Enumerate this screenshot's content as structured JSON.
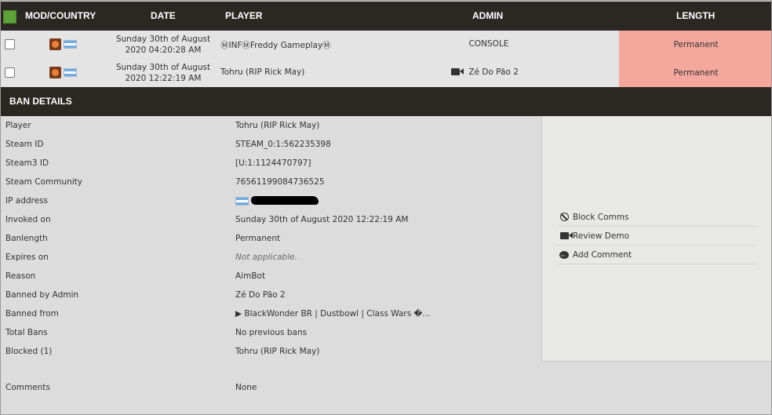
{
  "columns": {
    "mod_country": "MOD/COUNTRY",
    "date": "DATE",
    "player": "PLAYER",
    "admin": "ADMIN",
    "length": "LENGTH"
  },
  "bans": [
    {
      "date_line1": "Sunday 30th of August",
      "date_line2": "2020 04:20:28 AM",
      "player": "ⓂINFⓂFreddy GameplayⓂ",
      "admin": "CONSOLE",
      "admin_has_demo_icon": false,
      "length": "Permanent",
      "flag_icon": "argentina-flag-icon",
      "game_icon": "tf2-icon"
    },
    {
      "date_line1": "Sunday 30th of August",
      "date_line2": "2020 12:22:19 AM",
      "player": "Tohru (RIP Rick May)",
      "admin": "Zé Do Pão 2",
      "admin_has_demo_icon": true,
      "length": "Permanent",
      "flag_icon": "argentina-flag-icon",
      "game_icon": "tf2-icon"
    }
  ],
  "details": {
    "title": "BAN DETAILS",
    "rows": [
      {
        "label": "Player",
        "value": "Tohru (RIP Rick May)"
      },
      {
        "label": "Steam ID",
        "value": "STEAM_0:1:562235398"
      },
      {
        "label": "Steam3 ID",
        "value": "[U:1:1124470797]"
      },
      {
        "label": "Steam Community",
        "value": "76561199084736525"
      },
      {
        "label": "IP address",
        "value": ""
      },
      {
        "label": "Invoked on",
        "value": "Sunday 30th of August 2020 12:22:19 AM"
      },
      {
        "label": "Banlength",
        "value": "Permanent"
      },
      {
        "label": "Expires on",
        "value": "Not applicable."
      },
      {
        "label": "Reason",
        "value": "AimBot"
      },
      {
        "label": "Banned by Admin",
        "value": "Zé Do Pão 2"
      },
      {
        "label": "Banned from",
        "value": "▶ BlackWonder BR | Dustbowl | Class Wars �..."
      },
      {
        "label": "Total Bans",
        "value": "No previous bans"
      },
      {
        "label": "Blocked (1)",
        "value": "Tohru (RIP Rick May)"
      },
      {
        "label": "Comments",
        "value": "None"
      }
    ]
  },
  "actions": [
    {
      "label": "Block Comms",
      "icon": "ban-circle-icon"
    },
    {
      "label": "Review Demo",
      "icon": "video-camera-icon"
    },
    {
      "label": "Add Comment",
      "icon": "comment-bubble-icon"
    }
  ],
  "colors": {
    "header_bg": "#2b2722",
    "permanent_bg": "#f4a79c",
    "select_all": "#5fa13b"
  }
}
